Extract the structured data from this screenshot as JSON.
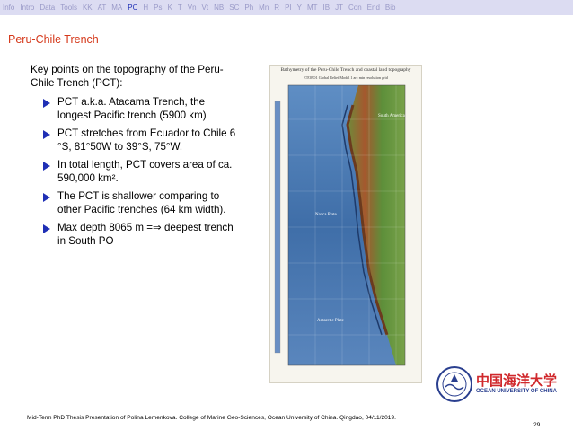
{
  "nav": {
    "items": [
      "Info",
      "Intro",
      "Data",
      "Tools",
      "KK",
      "AT",
      "MA",
      "PC",
      "H",
      "Ps",
      "K",
      "T",
      "Vn",
      "Vt",
      "NB",
      "SC",
      "Ph",
      "Mn",
      "R",
      "PI",
      "Y",
      "MT",
      "IB",
      "JT",
      "Con",
      "End",
      "Bib"
    ],
    "active": "PC"
  },
  "frame_title": "Peru-Chile Trench",
  "intro": "Key points on the topography of the Peru-Chile Trench (PCT):",
  "bullets": [
    "PCT a.k.a. Atacama Trench, the longest Pacific trench (5900 km)",
    "PCT stretches from Ecuador to Chile 6 °S, 81°50W to 39°S, 75°W.",
    "In total length, PCT covers area of ca. 590,000 km².",
    "The PCT is shallower comparing to other Pacific trenches (64 km width).",
    "Max depth 8065 m =⇒ deepest trench in South PO"
  ],
  "map": {
    "title": "Bathymetry of the Peru-Chile Trench and coastal land topography",
    "subtitle": "ETOPO1 Global Relief Model 1 arc min resolution grid",
    "labels": [
      "South America",
      "Nazca Plate",
      "Antarctic Plate"
    ]
  },
  "logo": {
    "cn": "中国海洋大学",
    "en": "OCEAN UNIVERSITY OF CHINA"
  },
  "footer": "Mid-Term PhD Thesis Presentation of Polina Lemenkova. College of Marine Geo-Sciences, Ocean University of China. Qingdao, 04/11/2019.",
  "page_number": "29"
}
